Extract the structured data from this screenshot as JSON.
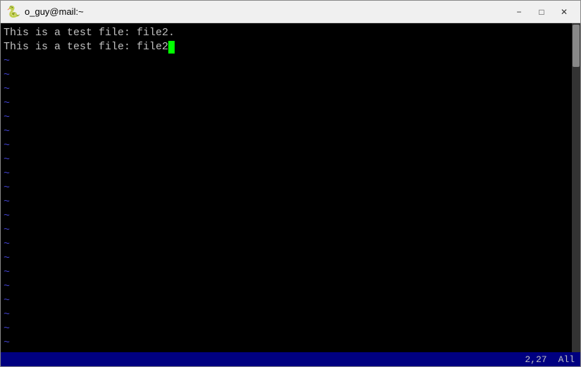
{
  "titlebar": {
    "title": "o_guy@mail:~",
    "minimize_label": "−",
    "maximize_label": "□",
    "close_label": "✕"
  },
  "terminal": {
    "line1": "This is a test file: file2.",
    "line2_prefix": "This is a test file: file2",
    "tilde_count": 22
  },
  "statusbar": {
    "position": "2,27",
    "view": "All"
  }
}
